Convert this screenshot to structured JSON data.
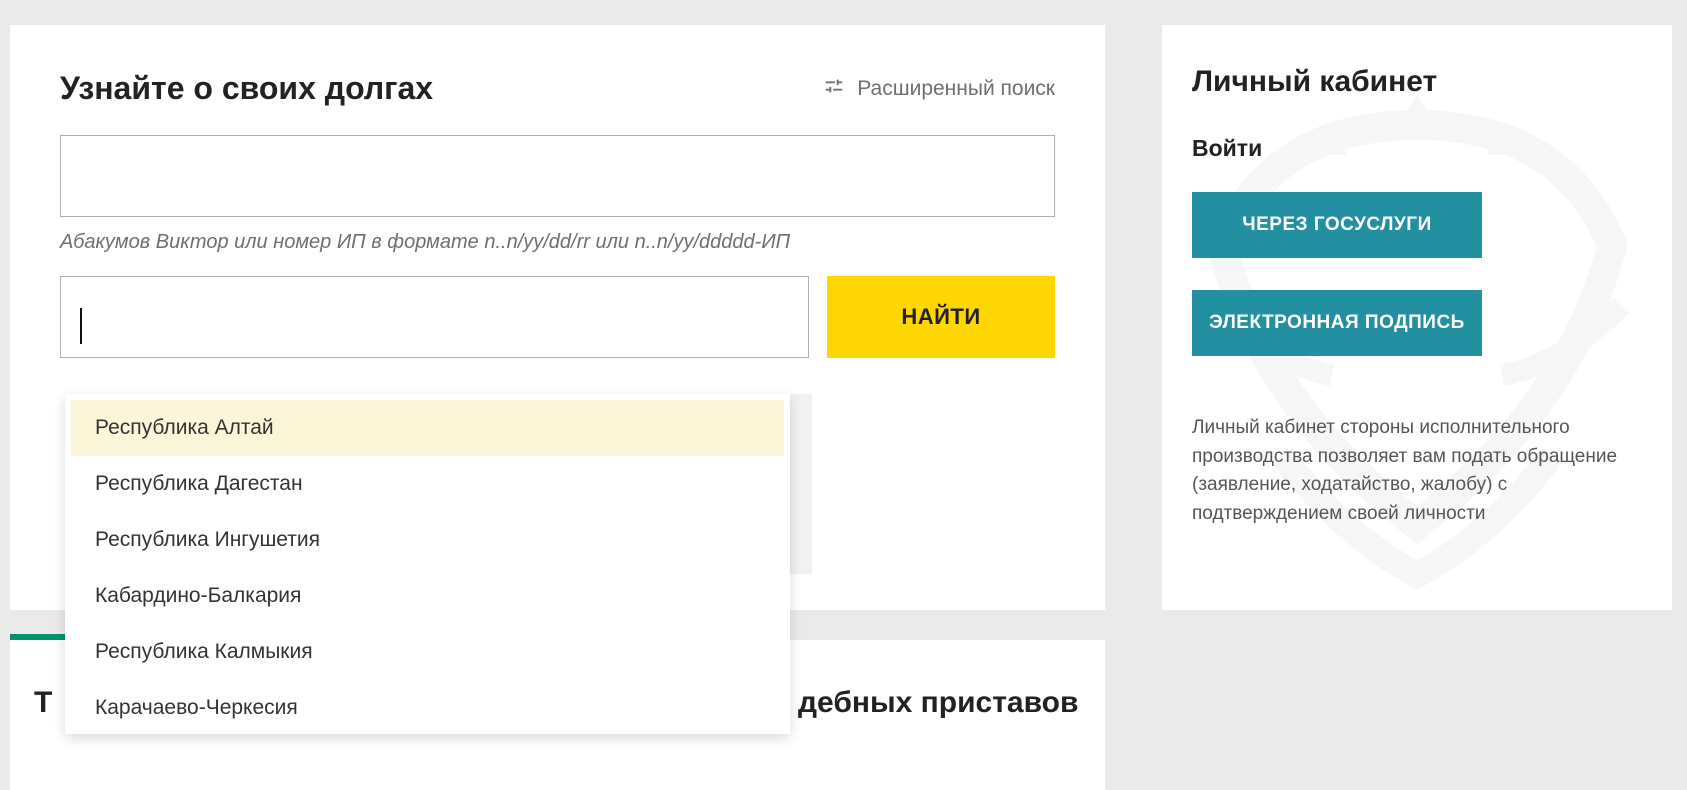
{
  "search": {
    "title": "Узнайте о своих долгах",
    "advanced_label": "Расширенный поиск",
    "helper": "Абакумов Виктор или номер ИП в формате n..n/yy/dd/rr или n..n/yy/ddddd-ИП",
    "find_label": "НАЙТИ"
  },
  "dropdown": {
    "items": [
      "Республика Алтай",
      "Республика Дагестан",
      "Республика Ингушетия",
      "Кабардино-Балкария",
      "Республика Калмыкия",
      "Карачаево-Черкесия"
    ],
    "highlighted_index": 0
  },
  "bottom": {
    "left_fragment": "Т",
    "right_fragment": "дебных приставов"
  },
  "sidebar": {
    "title": "Личный кабинет",
    "login_label": "Войти",
    "gosuslugi_label": "ЧЕРЕЗ ГОСУСЛУГИ",
    "signature_label": "ЭЛЕКТРОННАЯ ПОДПИСЬ",
    "description": "Личный кабинет стороны исполнительного производства позволяет вам подать обращение (заявление, ходатайство, жалобу) с подтверждением своей личности"
  }
}
